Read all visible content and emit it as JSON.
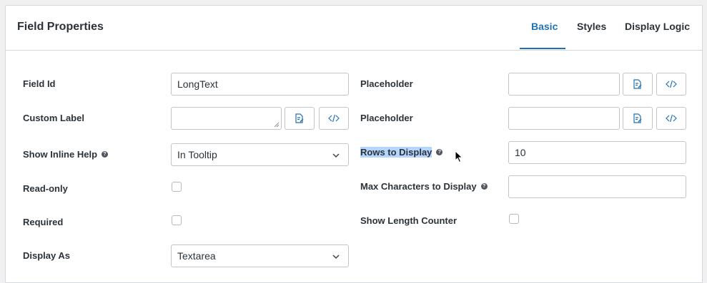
{
  "panel": {
    "title": "Field Properties"
  },
  "tabs": [
    {
      "label": "Basic",
      "active": true
    },
    {
      "label": "Styles",
      "active": false
    },
    {
      "label": "Display Logic",
      "active": false
    }
  ],
  "left_fields": {
    "field_id": {
      "label": "Field Id",
      "value": "LongText"
    },
    "custom_label": {
      "label": "Custom Label",
      "value": ""
    },
    "show_inline_help": {
      "label": "Show Inline Help",
      "value": "In Tooltip",
      "help_icon": "help-icon"
    },
    "read_only": {
      "label": "Read-only",
      "checked": false
    },
    "required": {
      "label": "Required",
      "checked": false
    },
    "display_as": {
      "label": "Display As",
      "value": "Textarea"
    }
  },
  "right_fields": {
    "placeholder_1": {
      "label": "Placeholder",
      "value": ""
    },
    "placeholder_2": {
      "label": "Placeholder",
      "value": ""
    },
    "rows_to_display": {
      "label": "Rows to Display",
      "value": "10",
      "help_icon": "help-icon"
    },
    "max_chars": {
      "label": "Max Characters to Display",
      "value": "",
      "help_icon": "help-icon"
    },
    "show_length_counter": {
      "label": "Show Length Counter",
      "checked": false
    }
  },
  "icons": {
    "translate": "translate-icon",
    "code": "code-icon",
    "chevron": "chevron-down-icon"
  },
  "colors": {
    "accent": "#2271b1",
    "selection": "#b4d5fe",
    "border": "#c3c4c7"
  },
  "help_glyph": "?"
}
